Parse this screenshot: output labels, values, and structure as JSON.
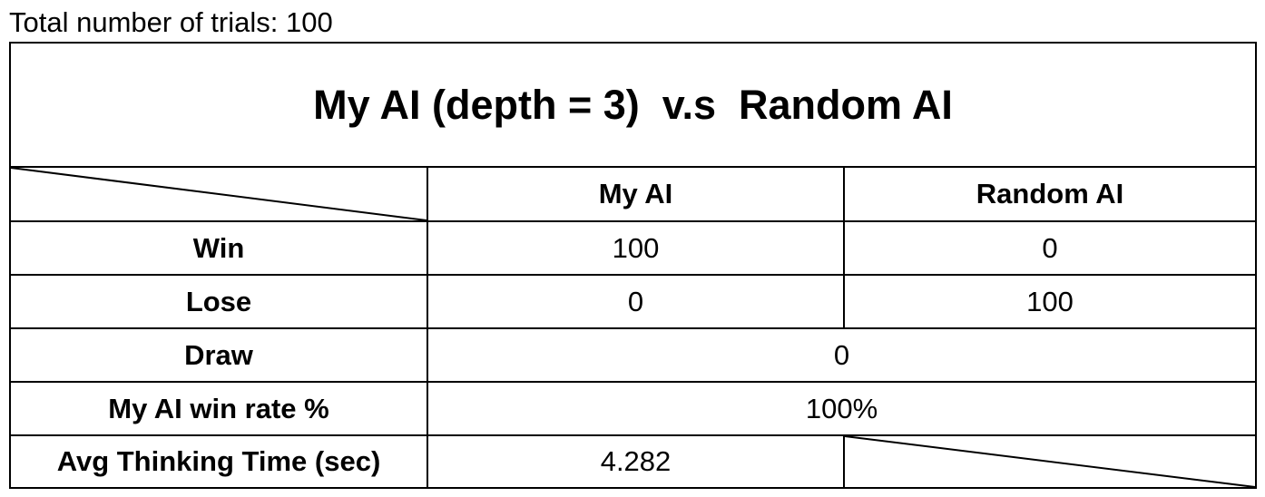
{
  "caption": "Total number of trials: 100",
  "table": {
    "title": "My AI (depth = 3)  v.s  Random AI",
    "columns": [
      "My AI",
      "Random AI"
    ],
    "rows": {
      "win": {
        "label": "Win",
        "my_ai": "100",
        "random_ai": "0"
      },
      "lose": {
        "label": "Lose",
        "my_ai": "0",
        "random_ai": "100"
      },
      "draw": {
        "label": "Draw",
        "merged": "0"
      },
      "win_rate": {
        "label": "My AI win rate %",
        "merged": "100%"
      },
      "thinking": {
        "label": "Avg Thinking Time (sec)",
        "my_ai": "4.282"
      }
    }
  }
}
